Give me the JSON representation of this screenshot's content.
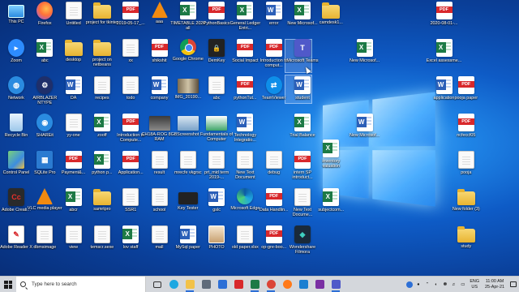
{
  "desktop": {
    "icons": [
      {
        "label": "This PC",
        "type": "thispc",
        "col": 0,
        "row": 0
      },
      {
        "label": "Firefox",
        "type": "firefox",
        "col": 1,
        "row": 0
      },
      {
        "label": "Untitled",
        "type": "file",
        "col": 2,
        "row": 0
      },
      {
        "label": "project for tkinter",
        "type": "folder",
        "col": 3,
        "row": 0
      },
      {
        "label": "2019-05-17_...",
        "type": "pdf",
        "col": 4,
        "row": 0
      },
      {
        "label": "aaa",
        "type": "vlc",
        "col": 5,
        "row": 0
      },
      {
        "label": "TIMETABLE 2020 all",
        "type": "xls",
        "col": 6,
        "row": 0
      },
      {
        "label": "PythonBasics",
        "type": "pdf",
        "col": 7,
        "row": 0
      },
      {
        "label": "General Ledger Entri...",
        "type": "xls",
        "col": 8,
        "row": 0
      },
      {
        "label": "error",
        "type": "doc",
        "col": 9,
        "row": 0
      },
      {
        "label": "New Microsof...",
        "type": "xls",
        "col": 10,
        "row": 0
      },
      {
        "label": "camdesk1...",
        "type": "folder",
        "col": 11,
        "row": 0
      },
      {
        "label": "2020-08-01-...",
        "type": "pdf",
        "col": 15,
        "row": 0,
        "xoff": -2
      },
      {
        "label": "Zoom",
        "type": "zoom",
        "col": 0,
        "row": 1
      },
      {
        "label": "abc",
        "type": "xls",
        "col": 1,
        "row": 1
      },
      {
        "label": "desktop",
        "type": "folder",
        "col": 2,
        "row": 1
      },
      {
        "label": "project on netbeans",
        "type": "folder",
        "col": 3,
        "row": 1
      },
      {
        "label": "xx",
        "type": "file",
        "col": 4,
        "row": 1
      },
      {
        "label": "shikshit",
        "type": "pdf",
        "col": 5,
        "row": 1
      },
      {
        "label": "Google Chrome",
        "type": "chrome",
        "col": 6,
        "row": 1
      },
      {
        "label": "DemKey",
        "type": "demkey",
        "col": 7,
        "row": 1
      },
      {
        "label": "Social Impact",
        "type": "pdf",
        "col": 8,
        "row": 1
      },
      {
        "label": "Introduction to comput...",
        "type": "pdf",
        "col": 9,
        "row": 1
      },
      {
        "label": "Microsoft Teams",
        "type": "teams",
        "col": 10,
        "row": 1
      },
      {
        "label": "New Microsof...",
        "type": "xls",
        "col": 12,
        "row": 1,
        "xoff": 6
      },
      {
        "label": "Excel assessme...",
        "type": "xls",
        "col": 15,
        "row": 1,
        "xoff": -2
      },
      {
        "label": "Network",
        "type": "network",
        "col": 0,
        "row": 2
      },
      {
        "label": "AIRBLAZER NTYPE",
        "type": "gear",
        "col": 1,
        "row": 2
      },
      {
        "label": "DA",
        "type": "doc",
        "col": 2,
        "row": 2
      },
      {
        "label": "recipes",
        "type": "file",
        "col": 3,
        "row": 2
      },
      {
        "label": "todo",
        "type": "file",
        "col": 4,
        "row": 2
      },
      {
        "label": "company",
        "type": "doc",
        "col": 5,
        "row": 2
      },
      {
        "label": "IMG_20190...",
        "type": "thumb1",
        "col": 6,
        "row": 2
      },
      {
        "label": "abc",
        "type": "file",
        "col": 7,
        "row": 2
      },
      {
        "label": "pythonTut...",
        "type": "pdf",
        "col": 8,
        "row": 2
      },
      {
        "label": "TeamViewer",
        "type": "teamviewer",
        "col": 9,
        "row": 2
      },
      {
        "label": "student",
        "type": "doc",
        "col": 10,
        "row": 2
      },
      {
        "label": "application",
        "type": "doc",
        "col": 15,
        "row": 2,
        "xoff": -2
      },
      {
        "label": "pooja paper",
        "type": "pdf",
        "col": 16,
        "row": 2,
        "xoff": -10
      },
      {
        "label": "Recycle Bin",
        "type": "recycle",
        "col": 0,
        "row": 3
      },
      {
        "label": "SHAREit",
        "type": "shareit",
        "col": 1,
        "row": 3
      },
      {
        "label": "yy-one",
        "type": "file",
        "col": 2,
        "row": 3
      },
      {
        "label": "zooff",
        "type": "xls",
        "col": 3,
        "row": 3
      },
      {
        "label": "Introduction to Compute...",
        "type": "pdf",
        "col": 4,
        "row": 3
      },
      {
        "label": "CH18A-ROG 8GB RAM",
        "type": "thumb2",
        "col": 5,
        "row": 3
      },
      {
        "label": "Screenshot",
        "type": "thumb3",
        "col": 6,
        "row": 3
      },
      {
        "label": "Fundamentals of Computer",
        "type": "thumb4",
        "col": 7,
        "row": 3
      },
      {
        "label": "Technology Integratio...",
        "type": "doc",
        "col": 8,
        "row": 3
      },
      {
        "label": "Trial Balance",
        "type": "xls",
        "col": 10,
        "row": 3
      },
      {
        "label": "New Microsof...",
        "type": "doc",
        "col": 12,
        "row": 3,
        "xoff": 6
      },
      {
        "label": "ncfeccf05",
        "type": "pdf",
        "col": 16,
        "row": 3,
        "xoff": -10
      },
      {
        "label": "Control Panel",
        "type": "controlpanel",
        "col": 0,
        "row": 4
      },
      {
        "label": "SQLite Pro",
        "type": "sqlite",
        "col": 1,
        "row": 4
      },
      {
        "label": "Payment&...",
        "type": "pdf",
        "col": 2,
        "row": 4
      },
      {
        "label": "python p...",
        "type": "xls",
        "col": 3,
        "row": 4
      },
      {
        "label": "Application...",
        "type": "pdf",
        "col": 4,
        "row": 4
      },
      {
        "label": "result",
        "type": "file",
        "col": 5,
        "row": 4
      },
      {
        "label": "mrecfe vkgrsc",
        "type": "file",
        "col": 6,
        "row": 4
      },
      {
        "label": "prt_mid term 2019-...",
        "type": "file",
        "col": 7,
        "row": 4
      },
      {
        "label": "New Text Document",
        "type": "file",
        "col": 8,
        "row": 4
      },
      {
        "label": "debug",
        "type": "file",
        "col": 9,
        "row": 4
      },
      {
        "label": "intern SP introduct...",
        "type": "pdf",
        "col": 10,
        "row": 4
      },
      {
        "label": "inventory valuation",
        "type": "xls",
        "col": 11,
        "row": 4,
        "yoff": -14
      },
      {
        "label": "pooja",
        "type": "file",
        "col": 16,
        "row": 4,
        "xoff": -10
      },
      {
        "label": "Adobe Creati...",
        "type": "adobecc",
        "col": 0,
        "row": 5
      },
      {
        "label": "VLC media player",
        "type": "vlc",
        "col": 1,
        "row": 5
      },
      {
        "label": "abcr",
        "type": "xls",
        "col": 2,
        "row": 5
      },
      {
        "label": "samrtpro",
        "type": "folder",
        "col": 3,
        "row": 5
      },
      {
        "label": "SSR1",
        "type": "file",
        "col": 4,
        "row": 5
      },
      {
        "label": "school",
        "type": "file",
        "col": 5,
        "row": 5
      },
      {
        "label": "Key Tester",
        "type": "keytester",
        "col": 6,
        "row": 5
      },
      {
        "label": "gslc",
        "type": "doc",
        "col": 7,
        "row": 5
      },
      {
        "label": "Microsoft Edge",
        "type": "edge",
        "col": 8,
        "row": 5
      },
      {
        "label": "Data Handlin...",
        "type": "pdf",
        "col": 9,
        "row": 5
      },
      {
        "label": "New Text Docume...",
        "type": "file",
        "col": 10,
        "row": 5
      },
      {
        "label": "subjectcom...",
        "type": "xls",
        "col": 11,
        "row": 5
      },
      {
        "label": "New folder (3)",
        "type": "folder",
        "col": 16,
        "row": 5,
        "xoff": -10
      },
      {
        "label": "Adobe Reader X",
        "type": "adobereader",
        "col": 0,
        "row": 6
      },
      {
        "label": "dbmsimage",
        "type": "file",
        "col": 1,
        "row": 6
      },
      {
        "label": "view",
        "type": "file",
        "col": 2,
        "row": 6
      },
      {
        "label": "temscr.sexe",
        "type": "file",
        "col": 3,
        "row": 6
      },
      {
        "label": "lov staff",
        "type": "xls",
        "col": 4,
        "row": 6
      },
      {
        "label": "mall",
        "type": "file",
        "col": 5,
        "row": 6
      },
      {
        "label": "MySql paper",
        "type": "doc",
        "col": 6,
        "row": 6
      },
      {
        "label": "PHOTO",
        "type": "photo",
        "col": 7,
        "row": 6
      },
      {
        "label": "old paper.xlsx",
        "type": "file",
        "col": 8,
        "row": 6
      },
      {
        "label": "op-gre-boo...",
        "type": "pdf",
        "col": 9,
        "row": 6
      },
      {
        "label": "Wondershare Filmora",
        "type": "filmora",
        "col": 10,
        "row": 6
      },
      {
        "label": "study",
        "type": "folder",
        "col": 16,
        "row": 6,
        "xoff": -10
      }
    ]
  },
  "taskbar": {
    "search_placeholder": "Type here to search",
    "apps": [
      {
        "name": "task-view-icon",
        "color": "#333333",
        "open": false
      },
      {
        "name": "edge-icon",
        "color": "#1ea7e1",
        "open": false
      },
      {
        "name": "file-explorer-icon",
        "color": "#f2c249",
        "open": true
      },
      {
        "name": "store-icon",
        "color": "#5f6b7a",
        "open": false
      },
      {
        "name": "mail-icon",
        "color": "#2d6fd6",
        "open": false
      },
      {
        "name": "acrobat-icon",
        "color": "#d8282b",
        "open": false
      },
      {
        "name": "excel-icon",
        "color": "#1d7a45",
        "open": true
      },
      {
        "name": "chrome-icon",
        "color": "#db4437",
        "open": true
      },
      {
        "name": "firefox-icon",
        "color": "#ff7a1a",
        "open": false
      },
      {
        "name": "ie-icon",
        "color": "#1b7fd1",
        "open": false
      },
      {
        "name": "onenote-icon",
        "color": "#7a2fa3",
        "open": false
      },
      {
        "name": "teams-icon",
        "color": "#5059c9",
        "open": true
      }
    ],
    "tray": {
      "lang_top": "ENG",
      "lang_bottom": "US",
      "time": "11:00 AM",
      "date": "25-Apr-21"
    }
  }
}
